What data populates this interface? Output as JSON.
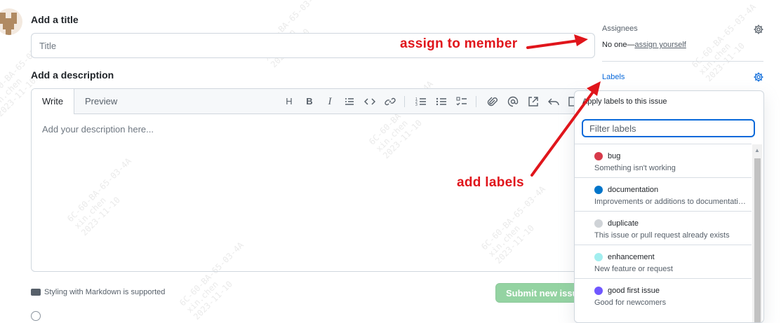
{
  "form": {
    "title_heading": "Add a title",
    "title_placeholder": "Title",
    "description_heading": "Add a description",
    "tabs": [
      "Write",
      "Preview"
    ],
    "description_placeholder": "Add your description here...",
    "markdown_hint": "Styling with Markdown is supported",
    "submit_label": "Submit new issue"
  },
  "toolbar": {
    "heading": "H",
    "bold": "B",
    "italic": "I",
    "icons": [
      "heading-icon",
      "bold-icon",
      "italic-icon",
      "quote-icon",
      "code-icon",
      "link-icon",
      "numbered-list-icon",
      "bullet-list-icon",
      "task-list-icon",
      "attach-icon",
      "mention-icon",
      "reference-icon",
      "undo-icon",
      "fullscreen-icon"
    ]
  },
  "sidebar": {
    "assignees_label": "Assignees",
    "assignees_value": "No one—",
    "assign_yourself": "assign yourself",
    "labels_label": "Labels"
  },
  "labels_dropdown": {
    "header": "Apply labels to this issue",
    "filter_placeholder": "Filter labels",
    "items": [
      {
        "name": "bug",
        "description": "Something isn't working",
        "color": "#d73a4a"
      },
      {
        "name": "documentation",
        "description": "Improvements or additions to documentation",
        "color": "#0075ca"
      },
      {
        "name": "duplicate",
        "description": "This issue or pull request already exists",
        "color": "#cfd3d7"
      },
      {
        "name": "enhancement",
        "description": "New feature or request",
        "color": "#a2eeef"
      },
      {
        "name": "good first issue",
        "description": "Good for newcomers",
        "color": "#7057ff"
      }
    ]
  },
  "annotations": {
    "assign": "assign to member",
    "labels": "add labels",
    "color": "#e0151b"
  },
  "watermark": {
    "lines": [
      "6C-60-BA-65-03-4A",
      "xin.chen",
      "2023-11-10"
    ]
  }
}
